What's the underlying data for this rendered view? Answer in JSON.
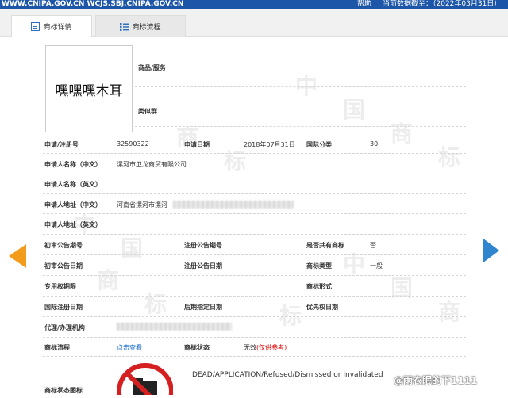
{
  "header": {
    "sites": "WWW.CNIPA.GOV.CN WCJS.SBJ.CNIPA.GOV.CN",
    "help": "帮助",
    "data_date": "当前数据截至：（2022年03月31日）"
  },
  "tabs": [
    {
      "label": "商标详情",
      "icon": "document-list-icon",
      "active": true
    },
    {
      "label": "商标流程",
      "icon": "list-icon",
      "active": false
    }
  ],
  "trademark": {
    "image_text": "嘿嘿嘿木耳",
    "goods_services_label": "商品/服务",
    "similar_group_label": "类似群"
  },
  "fields": {
    "reg_no_label": "申请/注册号",
    "reg_no": "32590322",
    "app_date_label": "申请日期",
    "app_date": "2018年07月31日",
    "intl_class_label": "国际分类",
    "intl_class": "30",
    "applicant_cn_label": "申请人名称（中文）",
    "applicant_cn": "漯河市卫龙商贸有限公司",
    "applicant_en_label": "申请人名称（英文）",
    "address_cn_label": "申请人地址（中文）",
    "address_cn": "河南省漯河市漯河",
    "address_en_label": "申请人地址（英文）",
    "prelim_pub_no_label": "初审公告期号",
    "reg_pub_no_label": "注册公告期号",
    "shared_label": "是否共有商标",
    "shared": "否",
    "prelim_pub_date_label": "初审公告日期",
    "reg_pub_date_label": "注册公告日期",
    "tm_type_label": "商标类型",
    "tm_type": "一般",
    "exclusive_period_label": "专用权期限",
    "tm_form_label": "商标形式",
    "intl_reg_date_label": "国际注册日期",
    "later_designation_label": "后期指定日期",
    "priority_date_label": "优先权日期",
    "agent_label": "代理/办理机构",
    "process_label": "商标流程",
    "process_link": "点击查看",
    "status_label": "商标状态",
    "status_value": "无效",
    "status_note": "(仅供参考)",
    "status_icon_label": "商标状态图标"
  },
  "status_icon": {
    "icon": "no-folder-icon",
    "text": "DEAD/APPLICATION/Refused/Dismissed or Invalidated",
    "color": "#d42020"
  },
  "watermark": {
    "text": [
      "中",
      "国",
      "商",
      "标"
    ]
  },
  "overlay": {
    "text": "@雨衣眠的下1111"
  },
  "colors": {
    "topbar": "#1d56a8",
    "left_arrow": "#f39b1a",
    "right_arrow": "#2f86cf",
    "link": "#1a6fcf"
  }
}
